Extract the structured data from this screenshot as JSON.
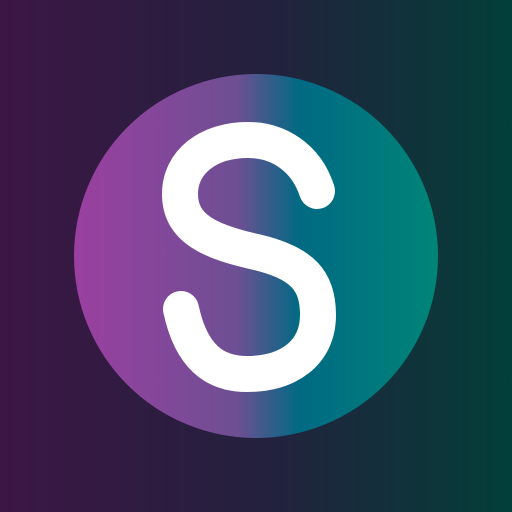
{
  "icon": {
    "logo_letter": "S",
    "logo_name": "s-logo-icon",
    "colors": {
      "background_left": "#3c1645",
      "background_mid": "#23213d",
      "background_right": "#023f39",
      "circle_left": "#9b3fa0",
      "circle_mid_left": "#6d4f93",
      "circle_mid_right": "#006a83",
      "circle_right": "#008577",
      "glyph": "#ffffff"
    }
  }
}
